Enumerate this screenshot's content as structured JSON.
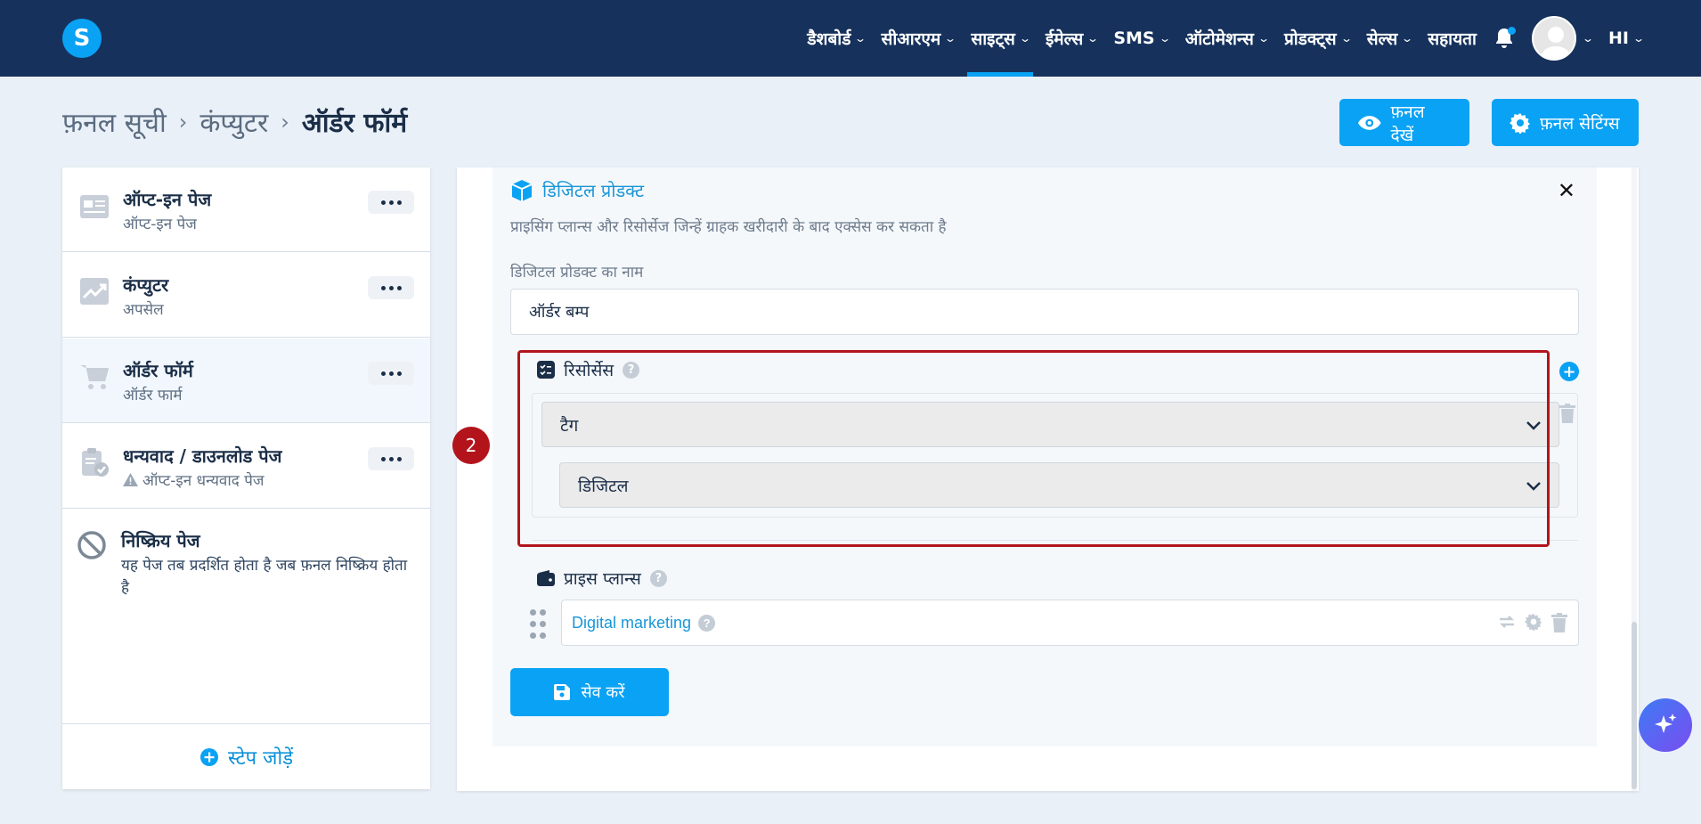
{
  "nav": {
    "logo": "S",
    "items": [
      {
        "label": "डैशबोर्ड"
      },
      {
        "label": "सीआरएम"
      },
      {
        "label": "साइट्स"
      },
      {
        "label": "ईमेल्स"
      },
      {
        "label": "SMS"
      },
      {
        "label": "ऑटोमेशन्स"
      },
      {
        "label": "प्रोडक्ट्स"
      },
      {
        "label": "सेल्स"
      }
    ],
    "help_label": "सहायता",
    "language": "HI",
    "accent_color": "#0aa2f4",
    "bar_color": "#16325c"
  },
  "breadcrumb": {
    "items": [
      "फ़नल सूची",
      "कंप्युटर",
      "ऑर्डर फॉर्म"
    ]
  },
  "header_buttons": {
    "view_funnel": "फ़नल देखें",
    "funnel_settings": "फ़नल सेटिंग्स"
  },
  "steps": [
    {
      "title": "ऑप्ट-इन पेज",
      "subtitle": "ऑप्ट-इन पेज",
      "icon": "page-layout-icon"
    },
    {
      "title": "कंप्युटर",
      "subtitle": "अपसेल",
      "icon": "chart-up-icon"
    },
    {
      "title": "ऑर्डर फॉर्म",
      "subtitle": "ऑर्डर फार्म",
      "icon": "cart-icon"
    },
    {
      "title": "धन्यवाद / डाउनलोड पेज",
      "subtitle": "ऑप्ट-इन धन्यवाद पेज",
      "icon": "clipboard-check-icon"
    }
  ],
  "inactive_page": {
    "title": "निष्क्रिय पेज",
    "description": "यह पेज तब प्रदर्शित होता है जब फ़नल निष्क्रिय होता है"
  },
  "add_step_label": "स्टेप जोड़ें",
  "digital_product": {
    "title": "डिजिटल प्रोडक्ट",
    "description": "प्राइसिंग प्लान्स और रिसोर्सेज जिन्हें ग्राहक खरीदारी के बाद एक्सेस कर सकता है",
    "name_label": "डिजिटल प्रोडक्ट का नाम",
    "name_value": "ऑर्डर बम्प",
    "resources_label": "रिसोर्सेस",
    "resource_type": "टैग",
    "resource_value": "डिजिटल",
    "price_plans_label": "प्राइस प्लान्स",
    "price_plan": "Digital marketing",
    "save_label": "सेव करें"
  },
  "annotation_number": "2"
}
